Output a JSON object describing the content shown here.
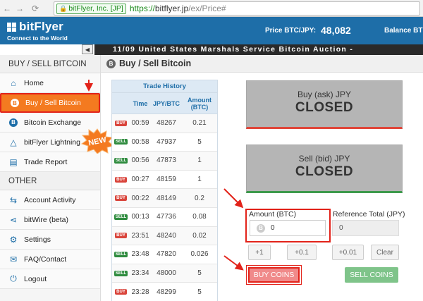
{
  "browser": {
    "back": "←",
    "forward": "→",
    "reload": "⟳",
    "lock": "🔒",
    "ev_label": "bitFlyer, Inc. [JP]",
    "url_scheme": "https://",
    "url_host": "bitflyer.jp",
    "url_path": "/ex/Price#"
  },
  "header": {
    "logo": "bitFlyer",
    "tagline": "Connect to the World",
    "price_label": "Price BTC/JPY:",
    "price_value": "48,082",
    "balance_label": "Balance BTC"
  },
  "ticker": {
    "text": "11/09 United States Marshals Service Bitcoin Auction -",
    "collapse": "◀"
  },
  "sidebar": {
    "section1": "BUY / SELL BITCOIN",
    "section2": "OTHER",
    "new_badge": "NEW",
    "items": [
      {
        "label": "Home",
        "icon": "home-icon",
        "glyph": "⌂"
      },
      {
        "label": "Buy / Sell Bitcoin",
        "icon": "bitcoin-icon",
        "glyph": "B"
      },
      {
        "label": "Bitcoin Exchange",
        "icon": "bitcoin-icon",
        "glyph": "B"
      },
      {
        "label": "bitFlyer Lightning",
        "icon": "lightning-icon",
        "glyph": "△"
      },
      {
        "label": "Trade Report",
        "icon": "report-icon",
        "glyph": "▤"
      }
    ],
    "other_items": [
      {
        "label": "Account Activity",
        "icon": "activity-icon",
        "glyph": "⇆"
      },
      {
        "label": "bitWire (beta)",
        "icon": "share-icon",
        "glyph": "⋖"
      },
      {
        "label": "Settings",
        "icon": "gear-icon",
        "glyph": "⚙"
      },
      {
        "label": "FAQ/Contact",
        "icon": "mail-icon",
        "glyph": "✉"
      },
      {
        "label": "Logout",
        "icon": "logout-icon",
        "glyph": "⏻"
      }
    ]
  },
  "main": {
    "title": "Buy / Sell Bitcoin",
    "title_icon": "B"
  },
  "trade_history": {
    "title": "Trade History",
    "columns": [
      "Time",
      "JPY/BTC",
      "Amount (BTC)"
    ],
    "rows": [
      {
        "side": "BUY",
        "time": "00:59",
        "price": "48267",
        "amount": "0.21"
      },
      {
        "side": "SELL",
        "time": "00:58",
        "price": "47937",
        "amount": "5"
      },
      {
        "side": "SELL",
        "time": "00:56",
        "price": "47873",
        "amount": "1"
      },
      {
        "side": "BUY",
        "time": "00:27",
        "price": "48159",
        "amount": "1"
      },
      {
        "side": "BUY",
        "time": "00:22",
        "price": "48149",
        "amount": "0.2"
      },
      {
        "side": "SELL",
        "time": "00:13",
        "price": "47736",
        "amount": "0.08"
      },
      {
        "side": "BUY",
        "time": "23:51",
        "price": "48240",
        "amount": "0.02"
      },
      {
        "side": "SELL",
        "time": "23:48",
        "price": "47820",
        "amount": "0.026"
      },
      {
        "side": "SELL",
        "time": "23:34",
        "price": "48000",
        "amount": "5"
      },
      {
        "side": "BUY",
        "time": "23:28",
        "price": "48299",
        "amount": "5"
      }
    ]
  },
  "order": {
    "ask_label": "Buy (ask) JPY",
    "ask_status": "CLOSED",
    "bid_label": "Sell (bid) JPY",
    "bid_status": "CLOSED",
    "amount_label": "Amount (BTC)",
    "amount_value": "0",
    "amount_icon": "B",
    "reference_label": "Reference Total (JPY)",
    "reference_value": "0",
    "steps": [
      "+1",
      "+0.1",
      "+0.01",
      "Clear"
    ],
    "buy_label": "BUY COINS",
    "sell_label": "SELL COINS"
  },
  "colors": {
    "brand_blue": "#1e6ea8",
    "active_orange": "#f47a20",
    "highlight_red": "#e2231a",
    "sell_green": "#2e8b3e"
  }
}
